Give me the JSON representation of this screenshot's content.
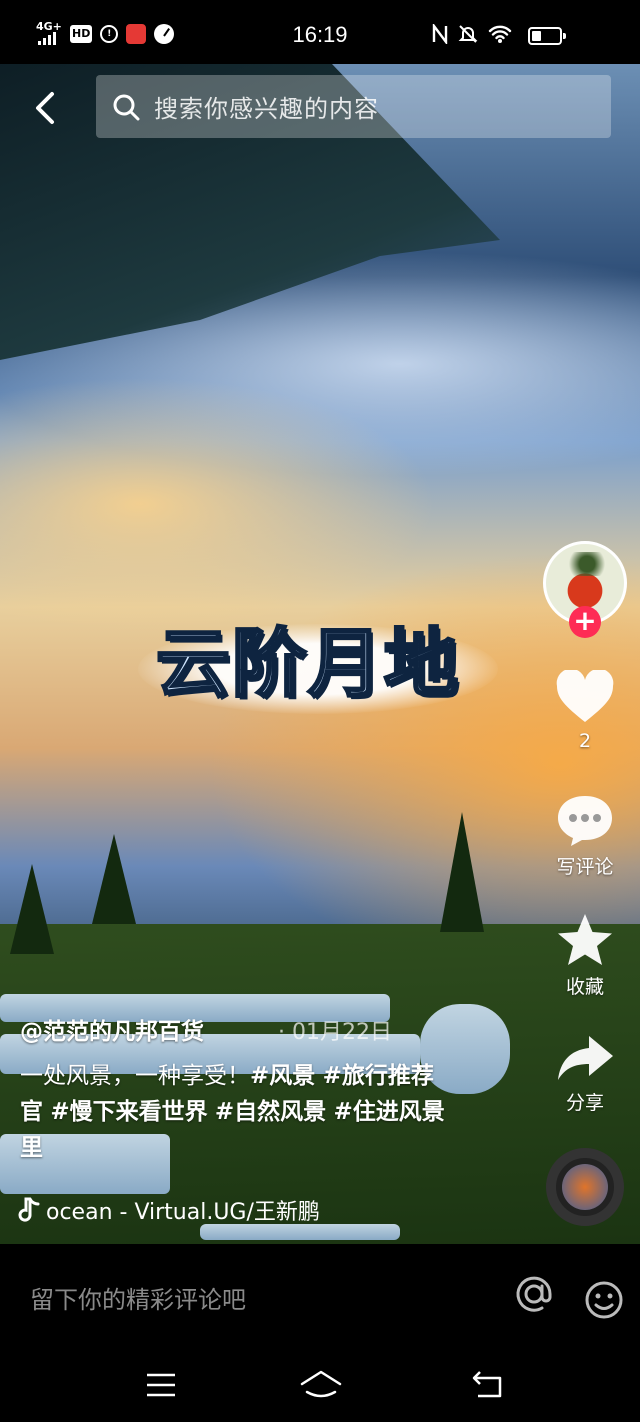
{
  "status_bar": {
    "network": "4G+",
    "hd": "HD",
    "time": "16:19",
    "colors": {
      "background": "#000000",
      "text": "#ffffff"
    }
  },
  "search": {
    "placeholder": "搜索你感兴趣的内容"
  },
  "video": {
    "title_art": "云阶月地"
  },
  "rail": {
    "like_count": "2",
    "comment_label": "写评论",
    "favorite_label": "收藏",
    "share_label": "分享",
    "follow_symbol": "+"
  },
  "caption": {
    "author": "@范范的凡邦百货",
    "date": "· 01月22日",
    "desc_parts": [
      {
        "text": "一处风景，一种享受！",
        "tag": false
      },
      {
        "text": "#风景",
        "tag": true
      },
      {
        "text": "#旅行推荐官",
        "tag": true
      },
      {
        "text": "#慢下来看世界",
        "tag": true
      },
      {
        "text": "#自然风景",
        "tag": true
      },
      {
        "text": "#住进风景里",
        "tag": true
      }
    ],
    "music": "ocean - Virtual.UG/王新鹏"
  },
  "comment_bar": {
    "placeholder": "留下你的精彩评论吧"
  },
  "icons": [
    "back-arrow-icon",
    "search-icon",
    "heart-icon",
    "comment-icon",
    "star-icon",
    "share-icon",
    "music-note-icon",
    "at-icon",
    "emoji-icon",
    "menu-icon",
    "home-icon",
    "back-icon"
  ],
  "accent": "#fe2c55"
}
